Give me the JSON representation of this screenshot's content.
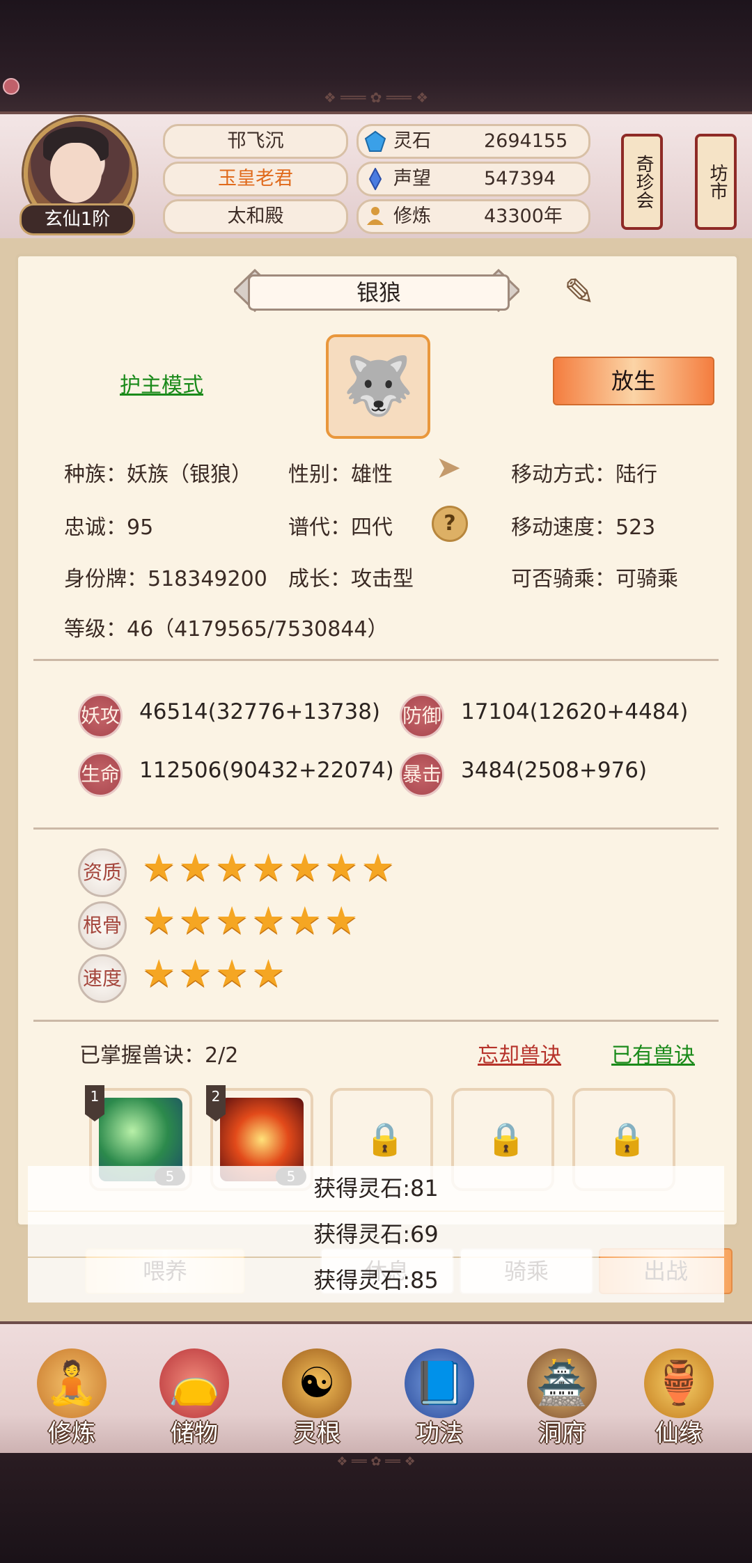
{
  "header": {
    "realm": "玄仙1阶",
    "names": [
      "邗飞沉",
      "玉皇老君",
      "太和殿"
    ],
    "resources": [
      {
        "label": "灵石",
        "value": "2694155",
        "icon": "spirit-stone-icon",
        "color": "#3aa0e8"
      },
      {
        "label": "声望",
        "value": "547394",
        "icon": "reputation-crystal-icon",
        "color": "#4a7ce0"
      },
      {
        "label": "修炼",
        "value": "43300年",
        "icon": "meditation-icon",
        "color": "#d89a3c"
      }
    ],
    "lanterns": [
      "奇珍会",
      "坊市"
    ]
  },
  "pet": {
    "name": "银狼",
    "mode_link": "护主模式",
    "release_label": "放生",
    "info": {
      "race": "种族：妖族（银狼）",
      "gender": "性别：雄性",
      "move_type": "移动方式：陆行",
      "loyalty": "忠诚：95",
      "generation": "谱代：四代",
      "move_speed": "移动速度：523",
      "id": "身份牌：518349200",
      "growth": "成长：攻击型",
      "rideable": "可否骑乘：可骑乘",
      "level": "等级：46（4179565/7530844）"
    },
    "stats": [
      {
        "label": "妖攻",
        "value": "46514(32776+13738)"
      },
      {
        "label": "防御",
        "value": "17104(12620+4484)"
      },
      {
        "label": "生命",
        "value": "112506(90432+22074)"
      },
      {
        "label": "暴击",
        "value": "3484(2508+976)"
      }
    ],
    "aptitudes": [
      {
        "label": "资质",
        "stars": 7,
        "stars_text": "★★★★★★★"
      },
      {
        "label": "根骨",
        "stars": 6,
        "stars_text": "★★★★★★"
      },
      {
        "label": "速度",
        "stars": 4,
        "stars_text": "★★★★"
      }
    ],
    "skills": {
      "mastered": "已掌握兽诀：2/2",
      "forget_link": "忘却兽诀",
      "have_link": "已有兽诀",
      "slots": [
        {
          "num": "1",
          "level": "5",
          "locked": false
        },
        {
          "num": "2",
          "level": "5",
          "locked": false
        },
        {
          "locked": true
        },
        {
          "locked": true
        },
        {
          "locked": true
        }
      ]
    },
    "actions": [
      "喂养",
      "休息",
      "骑乘",
      "出战"
    ]
  },
  "toasts": [
    "获得灵石:81",
    "获得灵石:69",
    "获得灵石:85"
  ],
  "nav": [
    {
      "label": "修炼",
      "icon": "cultivation-monk-icon"
    },
    {
      "label": "储物",
      "icon": "storage-bag-icon"
    },
    {
      "label": "灵根",
      "icon": "spirit-root-icon"
    },
    {
      "label": "功法",
      "icon": "technique-book-icon"
    },
    {
      "label": "洞府",
      "icon": "cave-mansion-icon"
    },
    {
      "label": "仙缘",
      "icon": "immortal-fate-icon"
    }
  ]
}
